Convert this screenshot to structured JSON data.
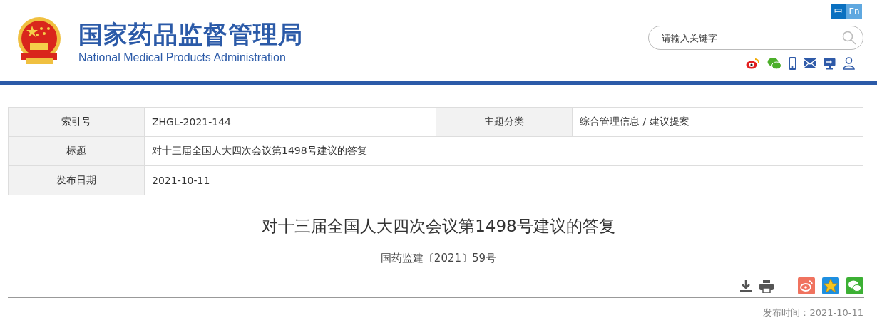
{
  "header": {
    "title": "国家药品监督管理局",
    "subtitle": "National Medical Products Administration"
  },
  "languages": [
    {
      "label": "中",
      "selected": true
    },
    {
      "label": "En",
      "selected": false
    }
  ],
  "search": {
    "placeholder": "请输入关键字"
  },
  "info_table": {
    "rows": [
      {
        "cells": [
          {
            "label": "索引号",
            "value": "ZHGL-2021-144"
          },
          {
            "label": "主题分类",
            "value": "综合管理信息 / 建议提案"
          }
        ]
      },
      {
        "cells": [
          {
            "label": "标题",
            "value": "对十三届全国人大四次会议第1498号建议的答复"
          }
        ]
      },
      {
        "cells": [
          {
            "label": "发布日期",
            "value": "2021-10-11"
          }
        ]
      }
    ]
  },
  "article": {
    "title": "对十三届全国人大四次会议第1498号建议的答复",
    "doc_number": "国药监建〔2021〕59号",
    "publish_time": "发布时间：2021-10-11"
  }
}
